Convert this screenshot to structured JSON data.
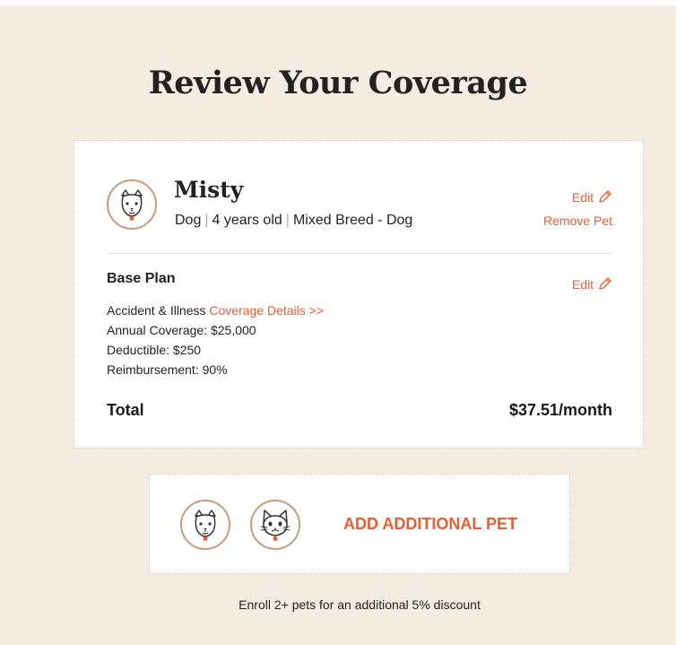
{
  "page_title": "Review Your Coverage",
  "colors": {
    "accent": "#e85d34",
    "background": "#f4ebe1",
    "avatar_ring": "#c99a7c"
  },
  "pet": {
    "avatar_icon": "dog-face-icon",
    "name": "Misty",
    "species": "Dog",
    "age": "4 years old",
    "breed": "Mixed Breed - Dog",
    "edit_label": "Edit",
    "remove_label": "Remove Pet"
  },
  "plan": {
    "title": "Base Plan",
    "edit_label": "Edit",
    "type_label": "Accident & Illness",
    "coverage_details_link": "Coverage Details >>",
    "annual_coverage": "Annual Coverage: $25,000",
    "deductible": "Deductible: $250",
    "reimbursement": "Reimbursement: 90%"
  },
  "total": {
    "label": "Total",
    "value": "$37.51/month"
  },
  "add_pet": {
    "icons": [
      "dog-face-icon",
      "cat-face-icon"
    ],
    "label": "ADD ADDITIONAL PET"
  },
  "discount_note": "Enroll 2+ pets for an additional 5% discount"
}
